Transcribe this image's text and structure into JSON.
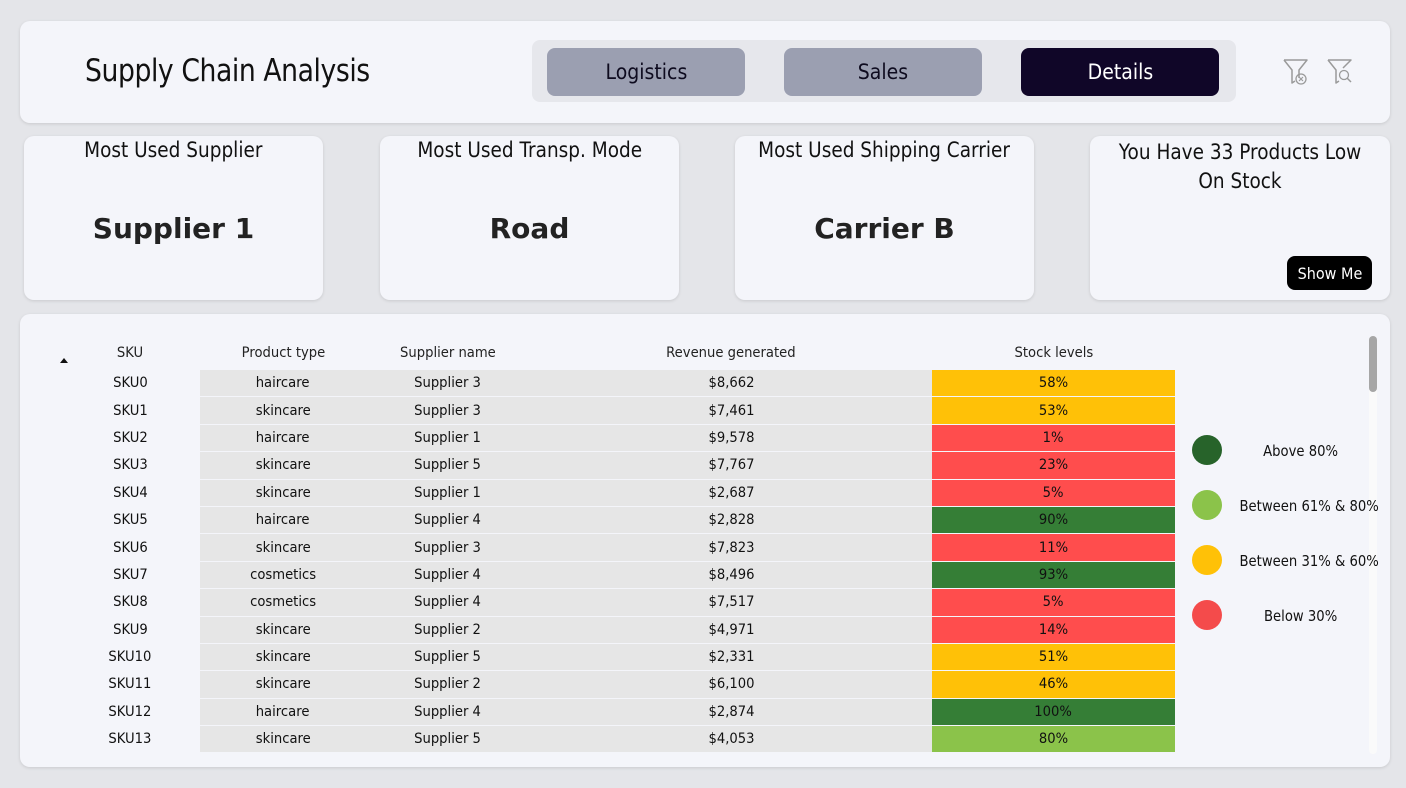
{
  "header": {
    "title": "Supply Chain Analysis",
    "nav": [
      {
        "label": "Logistics",
        "active": false
      },
      {
        "label": "Sales",
        "active": false
      },
      {
        "label": "Details",
        "active": true
      }
    ],
    "icons": [
      "clear-filters-icon",
      "search-filters-icon"
    ]
  },
  "cards": {
    "supplier": {
      "label": "Most Used Supplier",
      "value": "Supplier 1"
    },
    "transport": {
      "label": "Most Used Transp. Mode",
      "value": "Road"
    },
    "carrier": {
      "label": "Most Used Shipping Carrier",
      "value": "Carrier B"
    },
    "stock": {
      "label": "You Have 33  Products Low On Stock",
      "button_label": "Show Me"
    }
  },
  "table": {
    "columns": [
      "SKU",
      "Product type",
      "Supplier name",
      "Revenue generated",
      "Stock levels"
    ],
    "sort_column": "SKU",
    "rows": [
      {
        "sku": "SKU0",
        "type": "haircare",
        "supplier": "Supplier 3",
        "revenue": "$8,662",
        "stock": "58%",
        "level": "mid"
      },
      {
        "sku": "SKU1",
        "type": "skincare",
        "supplier": "Supplier 3",
        "revenue": "$7,461",
        "stock": "53%",
        "level": "mid"
      },
      {
        "sku": "SKU2",
        "type": "haircare",
        "supplier": "Supplier 1",
        "revenue": "$9,578",
        "stock": "1%",
        "level": "low"
      },
      {
        "sku": "SKU3",
        "type": "skincare",
        "supplier": "Supplier 5",
        "revenue": "$7,767",
        "stock": "23%",
        "level": "low"
      },
      {
        "sku": "SKU4",
        "type": "skincare",
        "supplier": "Supplier 1",
        "revenue": "$2,687",
        "stock": "5%",
        "level": "low"
      },
      {
        "sku": "SKU5",
        "type": "haircare",
        "supplier": "Supplier 4",
        "revenue": "$2,828",
        "stock": "90%",
        "level": "high"
      },
      {
        "sku": "SKU6",
        "type": "skincare",
        "supplier": "Supplier 3",
        "revenue": "$7,823",
        "stock": "11%",
        "level": "low"
      },
      {
        "sku": "SKU7",
        "type": "cosmetics",
        "supplier": "Supplier 4",
        "revenue": "$8,496",
        "stock": "93%",
        "level": "high"
      },
      {
        "sku": "SKU8",
        "type": "cosmetics",
        "supplier": "Supplier 4",
        "revenue": "$7,517",
        "stock": "5%",
        "level": "low"
      },
      {
        "sku": "SKU9",
        "type": "skincare",
        "supplier": "Supplier 2",
        "revenue": "$4,971",
        "stock": "14%",
        "level": "low"
      },
      {
        "sku": "SKU10",
        "type": "skincare",
        "supplier": "Supplier 5",
        "revenue": "$2,331",
        "stock": "51%",
        "level": "mid"
      },
      {
        "sku": "SKU11",
        "type": "skincare",
        "supplier": "Supplier 2",
        "revenue": "$6,100",
        "stock": "46%",
        "level": "mid"
      },
      {
        "sku": "SKU12",
        "type": "haircare",
        "supplier": "Supplier 4",
        "revenue": "$2,874",
        "stock": "100%",
        "level": "high"
      },
      {
        "sku": "SKU13",
        "type": "skincare",
        "supplier": "Supplier 5",
        "revenue": "$4,053",
        "stock": "80%",
        "level": "good"
      }
    ]
  },
  "legend": [
    {
      "label": "Above 80%",
      "color": "#27632a"
    },
    {
      "label": "Between 61% & 80%",
      "color": "#8bc34a"
    },
    {
      "label": "Between 31% & 60%",
      "color": "#ffc107"
    },
    {
      "label": "Below 30%",
      "color": "#f44b4b"
    }
  ],
  "level_colors": {
    "high": "#357e36",
    "good": "#8bc34a",
    "mid": "#ffc107",
    "low": "#ff4d4d"
  }
}
